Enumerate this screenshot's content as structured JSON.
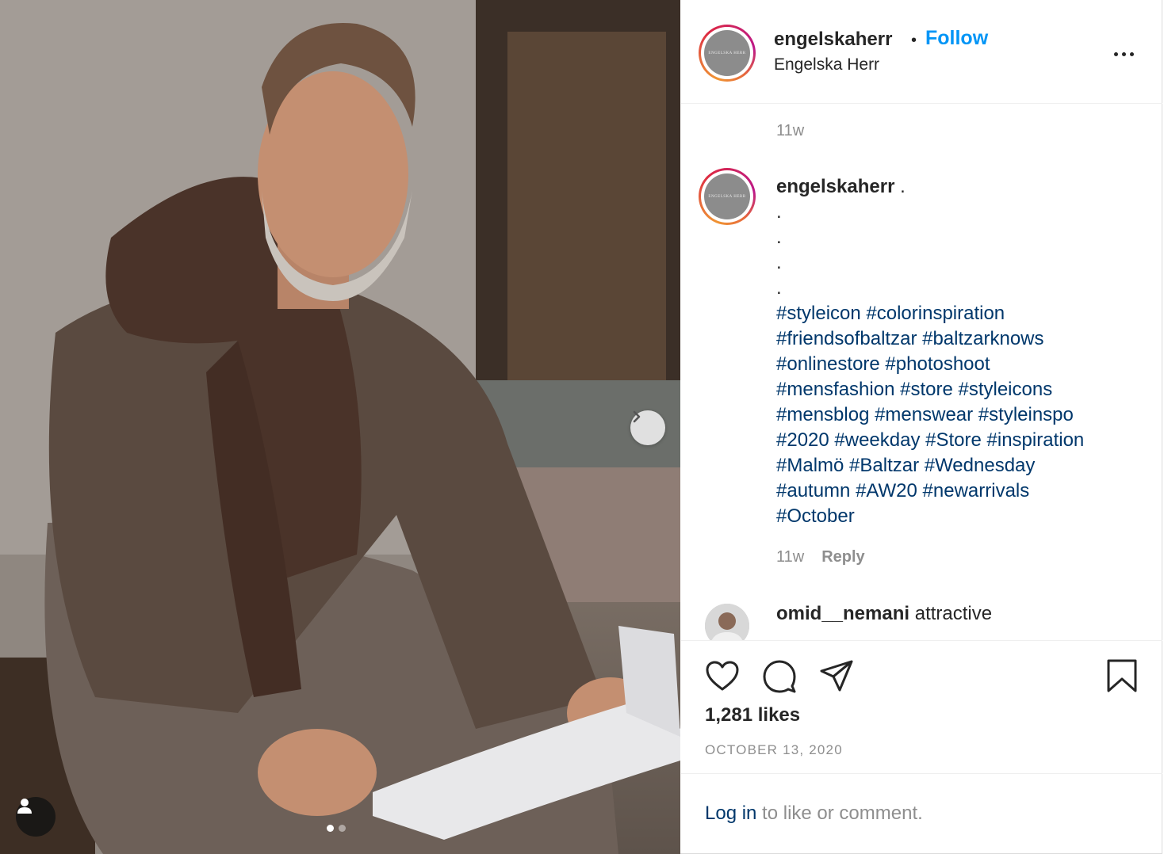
{
  "post": {
    "username": "engelskaherr",
    "bullet": "•",
    "follow_label": "Follow",
    "full_name": "Engelska Herr",
    "avatar_text": "ENGELSKA HERR",
    "top_timestamp": "11w"
  },
  "caption": {
    "username": "engelskaherr",
    "lead": " .",
    "dots": [
      ".",
      ".",
      ".",
      "."
    ],
    "hashtag_lines": [
      "#styleicon #colorinspiration",
      "#friendsofbaltzar #baltzarknows",
      "#onlinestore #photoshoot",
      "#mensfashion #store #styleicons",
      "#mensblog #menswear #styleinspo",
      "#2020 #weekday #Store #inspiration",
      "#Malmö #Baltzar #Wednesday",
      "#autumn #AW20 #newarrivals",
      "#October"
    ],
    "timestamp": "11w",
    "reply_label": "Reply"
  },
  "comment2": {
    "username": "omid__nemani",
    "text": " attractive"
  },
  "actions": {
    "likes": "1,281 likes",
    "date": "OCTOBER 13, 2020"
  },
  "login": {
    "link_label": "Log in",
    "rest": " to like or comment."
  },
  "carousel": {
    "slide_count": 2,
    "active_index": 0
  },
  "colors": {
    "follow": "#0095f6",
    "hashtag": "#00376b",
    "muted": "#8e8e8e"
  }
}
